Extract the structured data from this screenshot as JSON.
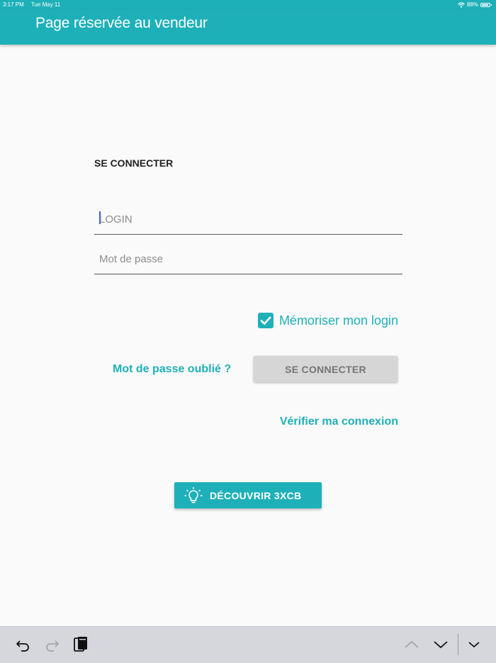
{
  "status_bar": {
    "time": "3:17 PM",
    "date": "Tue May 11",
    "battery": "88%",
    "battery_level": 0.88
  },
  "app_bar": {
    "title": "Page réservée au vendeur"
  },
  "login_form": {
    "heading": "SE CONNECTER",
    "login_placeholder": "LOGIN",
    "password_placeholder": "Mot de passe",
    "remember_label": "Mémoriser mon login",
    "remember_checked": true,
    "forgot_password": "Mot de passe oublié ?",
    "connect_button": "SE CONNECTER",
    "verify_connection": "Vérifier ma connexion"
  },
  "discover_button": {
    "label": "DÉCOUVRIR 3XCB",
    "icon": "lightbulb-icon"
  },
  "keyboard_toolbar": {
    "icons": [
      "undo-icon",
      "redo-icon",
      "paste-icon",
      "chevron-up-icon",
      "chevron-down-icon",
      "dismiss-keyboard-icon"
    ]
  },
  "colors": {
    "accent": "#1eb0b8",
    "button_disabled": "#d6d6d6"
  }
}
